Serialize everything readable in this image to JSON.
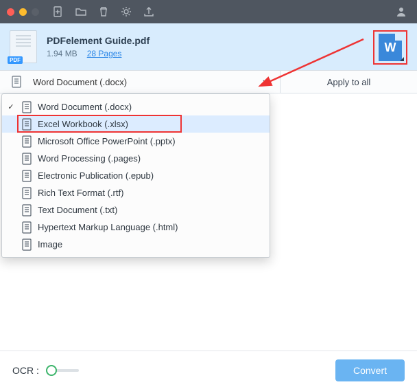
{
  "file": {
    "name": "PDFelement Guide.pdf",
    "size": "1.94 MB",
    "pages_link": "28 Pages",
    "thumb_tag": "PDF",
    "target_letter": "W"
  },
  "format_row": {
    "selected_label": "Word Document (.docx)",
    "apply_label": "Apply to all"
  },
  "dropdown": {
    "items": [
      {
        "label": "Word Document (.docx)",
        "checked": true
      },
      {
        "label": "Excel Workbook (.xlsx)",
        "checked": false,
        "hovered": true
      },
      {
        "label": "Microsoft Office PowerPoint (.pptx)",
        "checked": false
      },
      {
        "label": "Word Processing (.pages)",
        "checked": false
      },
      {
        "label": "Electronic Publication (.epub)",
        "checked": false
      },
      {
        "label": "Rich Text Format (.rtf)",
        "checked": false
      },
      {
        "label": "Text Document (.txt)",
        "checked": false
      },
      {
        "label": "Hypertext Markup Language (.html)",
        "checked": false
      },
      {
        "label": "Image",
        "checked": false
      }
    ]
  },
  "bottom": {
    "ocr_label": "OCR :",
    "ocr_on": false,
    "convert_label": "Convert"
  },
  "annotations": {
    "arrow_color": "#e33",
    "highlight_dropdown_index": 1,
    "highlight_target_icon": true
  }
}
